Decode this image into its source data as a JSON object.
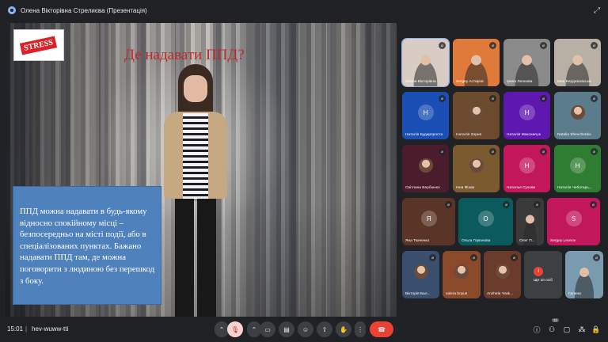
{
  "window": {
    "title": "Олена Вікторівна Стрелиєва (Презентація)"
  },
  "slide": {
    "logo_text": "STRESS",
    "title": "Де надавати ППД?",
    "body": "ППД можна надавати в будь-якому відносно спокійному місці – безпосередньо на місті події, або в спеціалізованих пунктах. Бажано надавати ППД там, де можна поговорити з людиною без перешкод з боку."
  },
  "participants": [
    {
      "name": "Олена Вікторівна ...",
      "initial": "",
      "color": "#d9ccc4",
      "kind": "camera"
    },
    {
      "name": "Sergey Aстapoв",
      "initial": "",
      "color": "#e07a3a",
      "kind": "camera"
    },
    {
      "name": "Ірина Леонова",
      "initial": "",
      "color": "#8a8a8a",
      "kind": "camera"
    },
    {
      "name": "Інна Бердніковська",
      "initial": "",
      "color": "#b8b0a4",
      "kind": "camera"
    },
    {
      "name": "Наталія Будирпроста",
      "initial": "Н",
      "color": "#1a4fb5",
      "kind": "initial"
    },
    {
      "name": "Наталія Зорня",
      "initial": "",
      "color": "#6b4a2e",
      "kind": "photo"
    },
    {
      "name": "Наталія Максимчук",
      "initial": "Н",
      "color": "#5e18b0",
      "kind": "initial"
    },
    {
      "name": "Natalia Shevchenko",
      "initial": "",
      "color": "#5b7c8a",
      "kind": "photo"
    },
    {
      "name": "Світлана Вербюнко",
      "initial": "",
      "color": "#4a1c2c",
      "kind": "photo"
    },
    {
      "name": "Інна Фізюк",
      "initial": "",
      "color": "#7a5a2e",
      "kind": "photo"
    },
    {
      "name": "Наталья Сухова",
      "initial": "Н",
      "color": "#c2185b",
      "kind": "initial"
    },
    {
      "name": "Наталія Чеботарь...",
      "initial": "Н",
      "color": "#2e7d32",
      "kind": "initial"
    },
    {
      "name": "Яна Ткаченко",
      "initial": "Я",
      "color": "#5a3426",
      "kind": "initial"
    },
    {
      "name": "Ольга Горюнова",
      "initial": "О",
      "color": "#0a5a5e",
      "kind": "initial"
    },
    {
      "name": "Олег П...",
      "initial": "",
      "color": "#3a3a3a",
      "kind": "camera"
    },
    {
      "name": "Sergey Leonov",
      "initial": "S",
      "color": "#c2185b",
      "kind": "initial"
    },
    {
      "name": "Вікторія Бал...",
      "initial": "",
      "color": "#3a4e6e",
      "kind": "photo"
    },
    {
      "name": "valera boyus",
      "initial": "",
      "color": "#8a4a2a",
      "kind": "photo"
    },
    {
      "name": "Anzhela Yeak...",
      "initial": "",
      "color": "#6a3a2a",
      "kind": "photo"
    },
    {
      "name": "Ще 10 осіб",
      "initial": "І",
      "color": "#3c4043",
      "kind": "more"
    },
    {
      "name": "Галина",
      "initial": "",
      "color": "#7a9ab0",
      "kind": "camera"
    }
  ],
  "bottombar": {
    "time": "15:01",
    "separator": "|",
    "meeting_code": "hev-wuww-tti",
    "participant_count": "31"
  },
  "icons": {
    "mic": "mic-off-icon",
    "camera": "camera-icon",
    "captions": "captions-icon",
    "emoji": "emoji-icon",
    "present": "present-icon",
    "hand": "raise-hand-icon",
    "more": "more-vert-icon",
    "leave": "leave-call-icon",
    "info": "info-icon",
    "people": "people-icon",
    "chat": "chat-icon",
    "activities": "activities-icon",
    "lock": "lock-icon"
  }
}
